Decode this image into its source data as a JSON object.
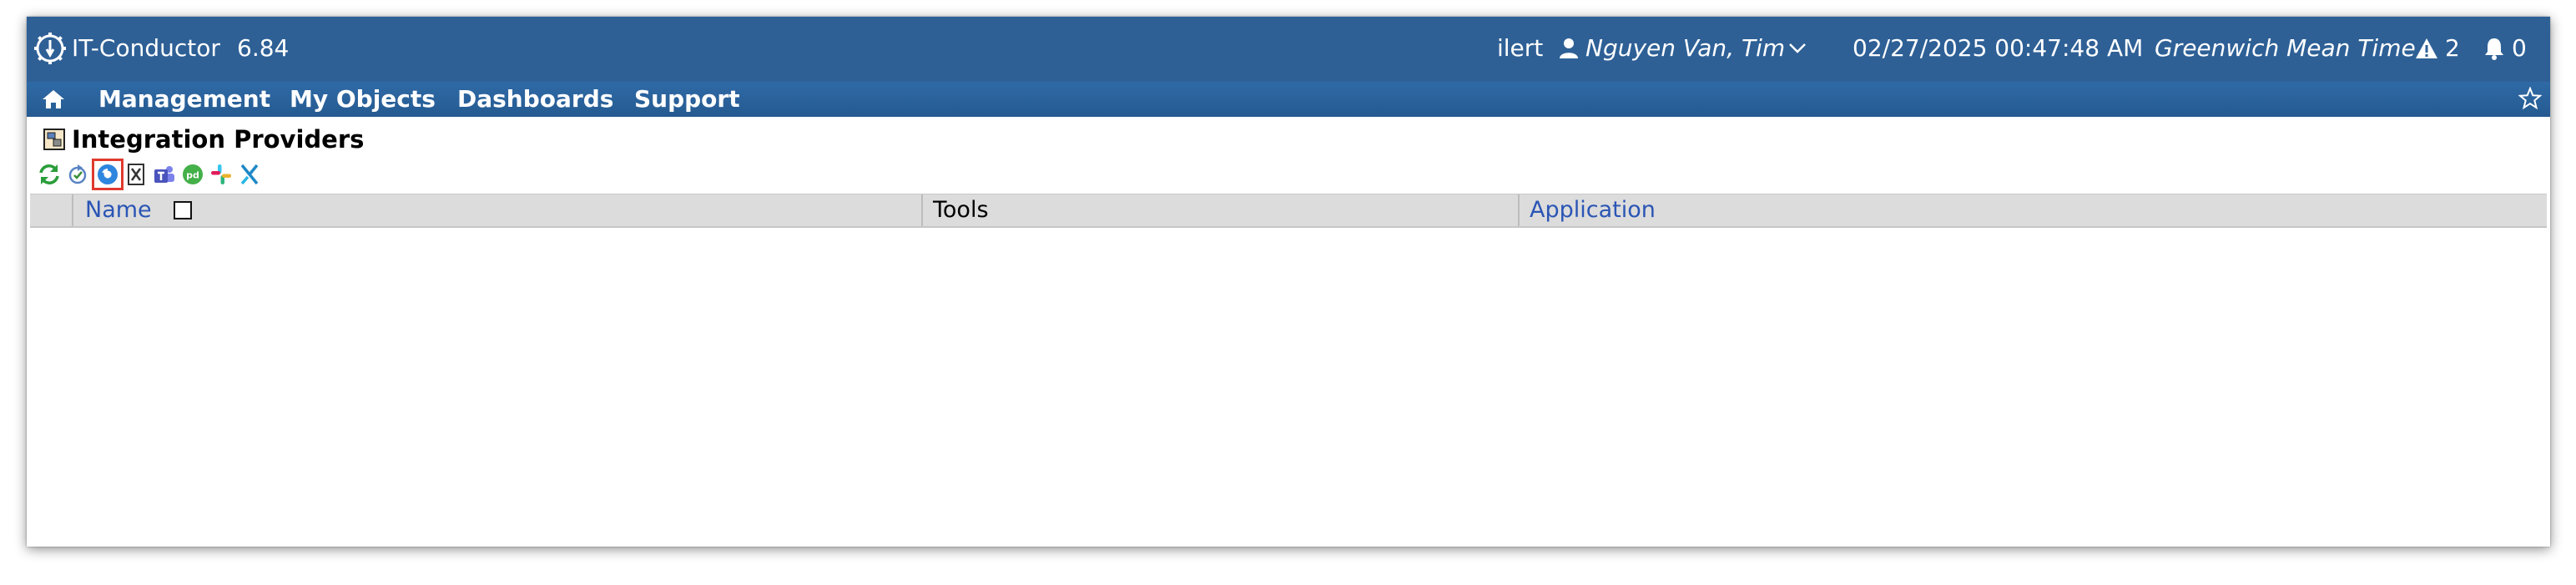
{
  "header": {
    "app_title": "IT-Conductor",
    "version": "6.84",
    "tenant": "ilert",
    "user": "Nguyen Van, Tim",
    "datetime": "02/27/2025 00:47:48 AM",
    "timezone": "Greenwich Mean Time",
    "alerts_count": "2",
    "notifications_count": "0"
  },
  "nav": {
    "home_icon": "home-icon",
    "items": [
      "Management",
      "My Objects",
      "Dashboards",
      "Support"
    ],
    "favorite_icon": "star-icon"
  },
  "page": {
    "title": "Integration Providers"
  },
  "toolbar": {
    "icons": [
      "refresh-icon",
      "reload-icon",
      "ilert-icon",
      "jira-icon",
      "teams-icon",
      "pagerduty-icon",
      "slack-icon",
      "xmatters-icon"
    ],
    "selected": "ilert-icon"
  },
  "table": {
    "columns": [
      "Name",
      "Tools",
      "Application"
    ],
    "rows": []
  },
  "colors": {
    "header_bg": "#2e6096",
    "nav_bg": "#2a64a0",
    "link": "#2a55b5",
    "selection_outline": "#e03a2e"
  }
}
